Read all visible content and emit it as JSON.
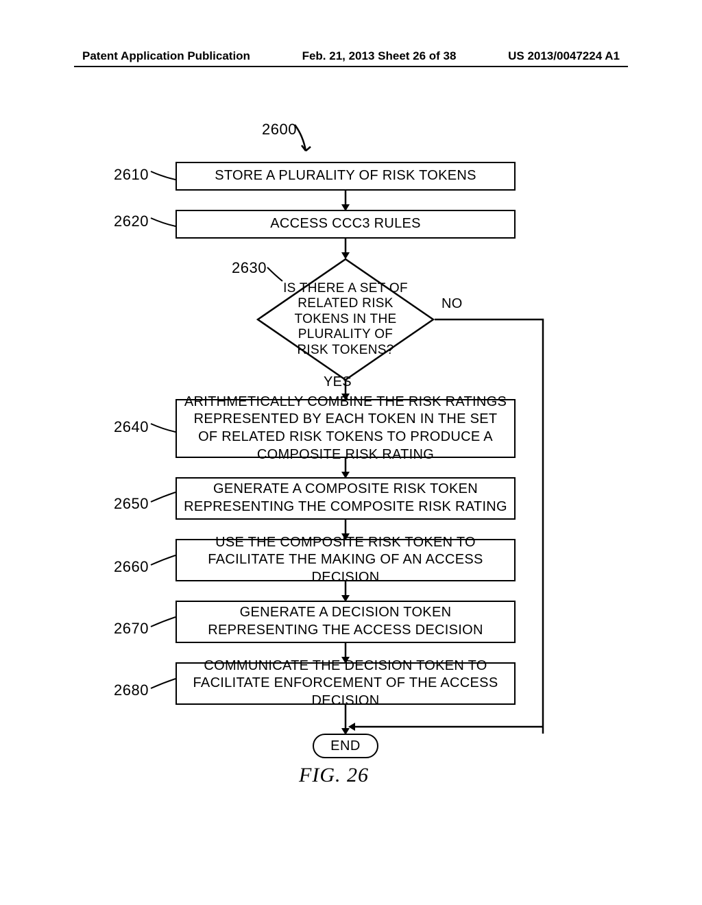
{
  "header": {
    "left": "Patent Application Publication",
    "center": "Feb. 21, 2013  Sheet 26 of 38",
    "right": "US 2013/0047224 A1"
  },
  "chart_data": {
    "type": "flowchart",
    "title": "FIG. 26",
    "nodes": [
      {
        "id": "2600",
        "ref": "2600",
        "type": "connector",
        "text": ""
      },
      {
        "id": "2610",
        "ref": "2610",
        "type": "process",
        "text": "STORE A PLURALITY OF RISK TOKENS"
      },
      {
        "id": "2620",
        "ref": "2620",
        "type": "process",
        "text": "ACCESS CCC3 RULES"
      },
      {
        "id": "2630",
        "ref": "2630",
        "type": "decision",
        "text": "IS THERE A SET OF RELATED RISK TOKENS IN THE PLURALITY OF RISK TOKENS?"
      },
      {
        "id": "2640",
        "ref": "2640",
        "type": "process",
        "text": "ARITHMETICALLY COMBINE THE RISK RATINGS REPRESENTED BY EACH TOKEN IN THE SET OF RELATED RISK TOKENS TO PRODUCE A COMPOSITE RISK RATING"
      },
      {
        "id": "2650",
        "ref": "2650",
        "type": "process",
        "text": "GENERATE A COMPOSITE RISK TOKEN REPRESENTING THE COMPOSITE RISK RATING"
      },
      {
        "id": "2660",
        "ref": "2660",
        "type": "process",
        "text": "USE THE COMPOSITE RISK TOKEN TO FACILITATE THE MAKING OF AN ACCESS DECISION"
      },
      {
        "id": "2670",
        "ref": "2670",
        "type": "process",
        "text": "GENERATE A DECISION TOKEN REPRESENTING THE ACCESS DECISION"
      },
      {
        "id": "2680",
        "ref": "2680",
        "type": "process",
        "text": "COMMUNICATE THE DECISION TOKEN TO FACILITATE ENFORCEMENT OF THE ACCESS DECISION"
      },
      {
        "id": "end",
        "ref": "",
        "type": "terminator",
        "text": "END"
      }
    ],
    "edges": [
      {
        "from": "2600",
        "to": "2610",
        "label": ""
      },
      {
        "from": "2610",
        "to": "2620",
        "label": ""
      },
      {
        "from": "2620",
        "to": "2630",
        "label": ""
      },
      {
        "from": "2630",
        "to": "2640",
        "label": "YES"
      },
      {
        "from": "2630",
        "to": "end",
        "label": "NO"
      },
      {
        "from": "2640",
        "to": "2650",
        "label": ""
      },
      {
        "from": "2650",
        "to": "2660",
        "label": ""
      },
      {
        "from": "2660",
        "to": "2670",
        "label": ""
      },
      {
        "from": "2670",
        "to": "2680",
        "label": ""
      },
      {
        "from": "2680",
        "to": "end",
        "label": ""
      }
    ]
  },
  "labels": {
    "yes": "YES",
    "no": "NO"
  },
  "caption": "FIG. 26"
}
